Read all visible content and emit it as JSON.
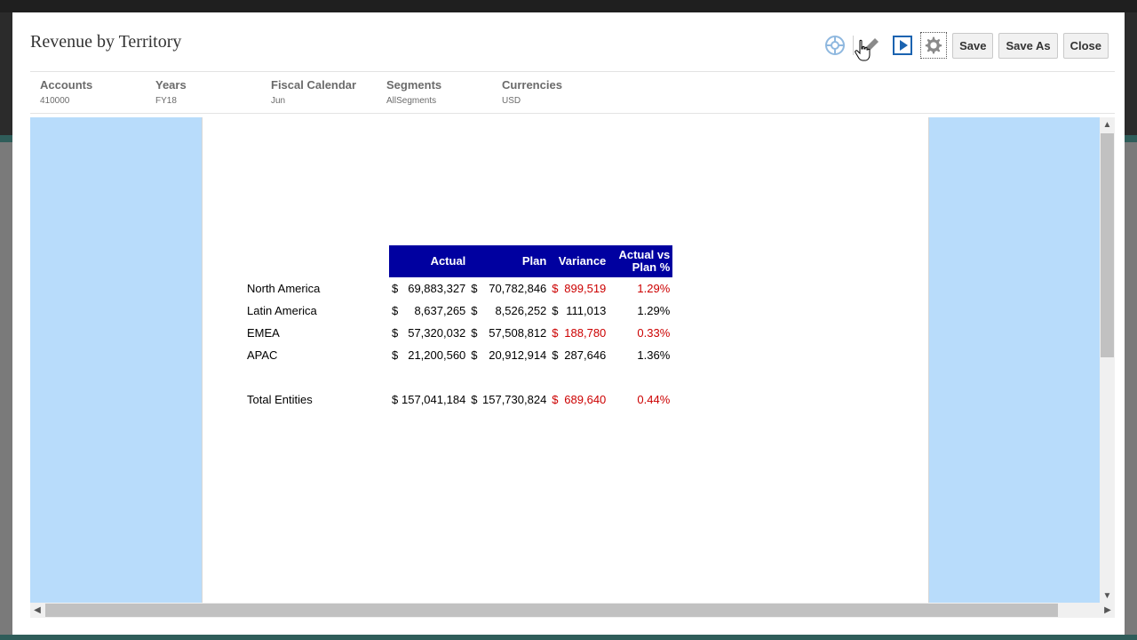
{
  "dialog": {
    "title": "Revenue by Territory"
  },
  "toolbar": {
    "icons": [
      "chart-wheel-icon",
      "pencil-icon",
      "play-icon",
      "gear-icon"
    ],
    "save_label": "Save",
    "save_as_label": "Save As",
    "close_label": "Close"
  },
  "pov": [
    {
      "label": "Accounts",
      "value": "410000"
    },
    {
      "label": "Years",
      "value": "FY18"
    },
    {
      "label": "Fiscal Calendar",
      "value": "Jun"
    },
    {
      "label": "Segments",
      "value": "AllSegments"
    },
    {
      "label": "Currencies",
      "value": "USD"
    }
  ],
  "report": {
    "headers": {
      "actual": "Actual",
      "plan": "Plan",
      "variance": "Variance",
      "pct_line1": "Actual vs",
      "pct_line2": "Plan %"
    },
    "currency_symbol": "$",
    "rows": [
      {
        "label": "North America",
        "actual": "69,883,327",
        "plan": "70,782,846",
        "variance": "899,519",
        "pct": "1.29%",
        "variance_negative": true,
        "pct_negative": true
      },
      {
        "label": "Latin America",
        "actual": "8,637,265",
        "plan": "8,526,252",
        "variance": "111,013",
        "pct": "1.29%",
        "variance_negative": false,
        "pct_negative": false
      },
      {
        "label": "EMEA",
        "actual": "57,320,032",
        "plan": "57,508,812",
        "variance": "188,780",
        "pct": "0.33%",
        "variance_negative": true,
        "pct_negative": true
      },
      {
        "label": "APAC",
        "actual": "21,200,560",
        "plan": "20,912,914",
        "variance": "287,646",
        "pct": "1.36%",
        "variance_negative": false,
        "pct_negative": false
      }
    ],
    "total": {
      "label": "Total Entities",
      "actual": "157,041,184",
      "plan": "157,730,824",
      "variance": "689,640",
      "pct": "0.44%",
      "variance_negative": true,
      "pct_negative": true
    }
  },
  "colors": {
    "header_bg": "#0000a0",
    "negative": "#cc0000",
    "canvas_bg": "#b8dcfb",
    "icon_blue": "#1b63b0",
    "icon_gray": "#8a8a8a"
  }
}
